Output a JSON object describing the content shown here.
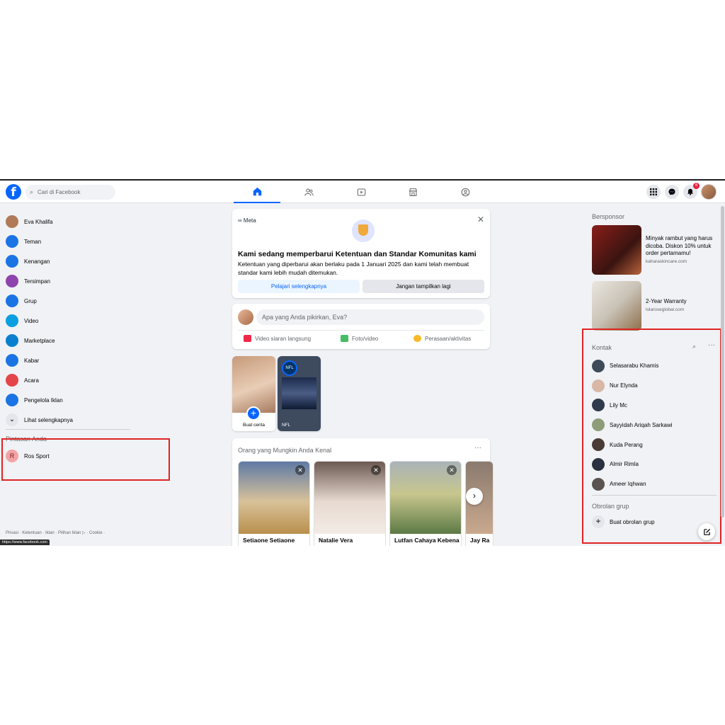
{
  "search": {
    "placeholder": "Cari di Facebook"
  },
  "topbar": {
    "notification_count": "6"
  },
  "left_nav": [
    {
      "label": "Eva Khalifa",
      "icon": "user-avatar",
      "color": "#b07a58"
    },
    {
      "label": "Teman",
      "icon": "friends-icon",
      "color": "#1b74e4"
    },
    {
      "label": "Kenangan",
      "icon": "memories-icon",
      "color": "#1b74e4"
    },
    {
      "label": "Tersimpan",
      "icon": "bookmark-icon",
      "color": "#8e44ad"
    },
    {
      "label": "Grup",
      "icon": "groups-icon",
      "color": "#1b74e4"
    },
    {
      "label": "Video",
      "icon": "video-icon",
      "color": "#0a9fe0"
    },
    {
      "label": "Marketplace",
      "icon": "marketplace-icon",
      "color": "#0a7fd0"
    },
    {
      "label": "Kabar",
      "icon": "feeds-icon",
      "color": "#1b74e4"
    },
    {
      "label": "Acara",
      "icon": "calendar-icon",
      "color": "#e4454a"
    },
    {
      "label": "Pengelola Iklan",
      "icon": "ads-manager-icon",
      "color": "#1b74e4"
    },
    {
      "label": "Lihat selengkapnya",
      "icon": "chevron-down-icon",
      "color": "#e4e6eb"
    }
  ],
  "shortcuts": {
    "title": "Pintasan Anda",
    "items": [
      {
        "label": "Ros Sport",
        "initial": "R"
      }
    ]
  },
  "footer": {
    "links": "Privasi · Ketentuan · Iklan · Pilihan Iklan ▷ · Cookie ·"
  },
  "status_bar": {
    "url": "https://www.facebook.com"
  },
  "meta_notice": {
    "brand": "∞ Meta",
    "title": "Kami sedang memperbarui Ketentuan dan Standar Komunitas kami",
    "description": "Ketentuan yang diperbarui akan berlaku pada 1 Januari 2025 dan kami telah membuat standar kami lebih mudah ditemukan.",
    "primary_button": "Pelajari selengkapnya",
    "secondary_button": "Jangan tampilkan lagi"
  },
  "composer": {
    "placeholder": "Apa yang Anda pikirkan, Eva?",
    "actions": [
      {
        "label": "Video siaran langsung",
        "color": "#f02849"
      },
      {
        "label": "Foto/video",
        "color": "#45bd62"
      },
      {
        "label": "Perasaan/aktivitas",
        "color": "#f7b928"
      }
    ]
  },
  "stories": {
    "create_label": "Buat cerita",
    "nfl_label": "NFL",
    "nfl_logo": "NFL"
  },
  "pymk": {
    "title": "Orang yang Mungkin Anda Kenal",
    "people": [
      {
        "name": "Setiaone Setiaone"
      },
      {
        "name": "Natalie Vera"
      },
      {
        "name": "Lutfan Cahaya Kebena"
      },
      {
        "name": "Jay Ra"
      }
    ]
  },
  "sponsored": {
    "title": "Bersponsor",
    "ads": [
      {
        "text": "Minyak rambut yang harus dicoba. Diskon 10% untuk order pertamamu!",
        "domain": "kaharaskincare.com"
      },
      {
        "text": "2-Year Warranty",
        "domain": "lolaroseglobal.com"
      }
    ]
  },
  "contacts": {
    "title": "Kontak",
    "people": [
      {
        "name": "Selasarabu Khamis",
        "color": "#3c4a5a"
      },
      {
        "name": "Nur Elynda",
        "color": "#d8b7a6"
      },
      {
        "name": "Lily Mc",
        "color": "#2f3a4d"
      },
      {
        "name": "Sayyidah Ariqah Sarkawi",
        "color": "#8e9c7a"
      },
      {
        "name": "Kuda Perang",
        "color": "#4a3b35"
      },
      {
        "name": "Almir Rimla",
        "color": "#2a3140"
      },
      {
        "name": "Ameer Iqhwan",
        "color": "#5a5350"
      }
    ]
  },
  "group_chats": {
    "title": "Obrolan grup",
    "create_label": "Buat obrolan grup"
  }
}
